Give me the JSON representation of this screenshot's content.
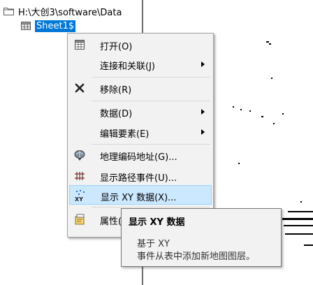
{
  "tree": {
    "folder_path": "H:\\大创3\\software\\Data",
    "selected_item": "Sheet1$"
  },
  "context_menu": {
    "items": [
      {
        "label": "打开(O)",
        "icon": "table-icon",
        "submenu": false
      },
      {
        "label": "连接和关联(J)",
        "icon": "",
        "submenu": true
      },
      {
        "label": "移除(R)",
        "icon": "remove-x-icon",
        "submenu": false
      },
      {
        "label": "数据(D)",
        "icon": "",
        "submenu": true
      },
      {
        "label": "编辑要素(E)",
        "icon": "",
        "submenu": true
      },
      {
        "label": "地理编码地址(G)...",
        "icon": "geocode-icon",
        "submenu": false
      },
      {
        "label": "显示路径事件(U)...",
        "icon": "route-events-icon",
        "submenu": false
      },
      {
        "label": "显示 XY 数据(X)...",
        "icon": "xy-data-icon",
        "submenu": false,
        "highlighted": true
      },
      {
        "label": "属性(",
        "icon": "properties-icon",
        "submenu": false
      }
    ]
  },
  "tooltip": {
    "title": "显示 XY 数据",
    "line1": "基于 XY",
    "line2": "事件从表中添加新地图图层。"
  },
  "colors": {
    "selection": "#0078d7",
    "menu_background": "#f2f2f2",
    "menu_highlight": "#cce8ff"
  }
}
